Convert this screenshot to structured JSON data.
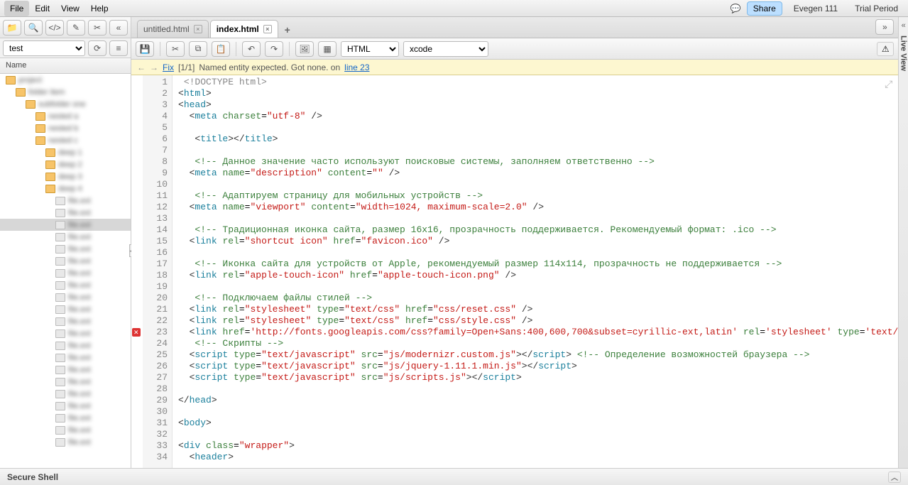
{
  "menubar": {
    "items": [
      "File",
      "Edit",
      "View",
      "Help"
    ],
    "share": "Share",
    "user": "Evegen 111",
    "trial": "Trial Period"
  },
  "sidebar": {
    "search_value": "test",
    "header": "Name",
    "tree": [
      {
        "depth": 0,
        "type": "folder",
        "label": "project",
        "selected": false
      },
      {
        "depth": 1,
        "type": "folder",
        "label": "folder item",
        "selected": false
      },
      {
        "depth": 2,
        "type": "folder",
        "label": "subfolder one",
        "selected": false
      },
      {
        "depth": 3,
        "type": "folder",
        "label": "nested a",
        "selected": false
      },
      {
        "depth": 3,
        "type": "folder",
        "label": "nested b",
        "selected": false
      },
      {
        "depth": 3,
        "type": "folder",
        "label": "nested c",
        "selected": false
      },
      {
        "depth": 4,
        "type": "folder",
        "label": "deep 1",
        "selected": false
      },
      {
        "depth": 4,
        "type": "folder",
        "label": "deep 2",
        "selected": false
      },
      {
        "depth": 4,
        "type": "folder",
        "label": "deep 3",
        "selected": false
      },
      {
        "depth": 4,
        "type": "folder",
        "label": "deep 4",
        "selected": false
      },
      {
        "depth": 5,
        "type": "file",
        "label": "file.ext",
        "selected": false
      },
      {
        "depth": 5,
        "type": "file",
        "label": "file.ext",
        "selected": false
      },
      {
        "depth": 5,
        "type": "file",
        "label": "file.ext",
        "selected": true
      },
      {
        "depth": 5,
        "type": "file",
        "label": "file.ext",
        "selected": false
      },
      {
        "depth": 5,
        "type": "file",
        "label": "file.ext",
        "selected": false
      },
      {
        "depth": 5,
        "type": "file",
        "label": "file.ext",
        "selected": false
      },
      {
        "depth": 5,
        "type": "file",
        "label": "file.ext",
        "selected": false
      },
      {
        "depth": 5,
        "type": "file",
        "label": "file.ext",
        "selected": false
      },
      {
        "depth": 5,
        "type": "file",
        "label": "file.ext",
        "selected": false
      },
      {
        "depth": 5,
        "type": "file",
        "label": "file.ext",
        "selected": false
      },
      {
        "depth": 5,
        "type": "file",
        "label": "file.ext",
        "selected": false
      },
      {
        "depth": 5,
        "type": "file",
        "label": "file.ext",
        "selected": false
      },
      {
        "depth": 5,
        "type": "file",
        "label": "file.ext",
        "selected": false
      },
      {
        "depth": 5,
        "type": "file",
        "label": "file.ext",
        "selected": false
      },
      {
        "depth": 5,
        "type": "file",
        "label": "file.ext",
        "selected": false
      },
      {
        "depth": 5,
        "type": "file",
        "label": "file.ext",
        "selected": false
      },
      {
        "depth": 5,
        "type": "file",
        "label": "file.ext",
        "selected": false
      },
      {
        "depth": 5,
        "type": "file",
        "label": "file.ext",
        "selected": false
      },
      {
        "depth": 5,
        "type": "file",
        "label": "file.ext",
        "selected": false
      },
      {
        "depth": 5,
        "type": "file",
        "label": "file.ext",
        "selected": false
      },
      {
        "depth": 5,
        "type": "file",
        "label": "file.ext",
        "selected": false
      }
    ]
  },
  "tabs": [
    {
      "label": "untitled.html",
      "active": false
    },
    {
      "label": "index.html",
      "active": true
    }
  ],
  "editor_toolbar": {
    "lang_select": "HTML",
    "theme_select": "xcode"
  },
  "lint": {
    "fix": "Fix",
    "counter": "[1/1]",
    "message": "Named entity expected. Got none. on",
    "line_ref": "line 23"
  },
  "code_lines": [
    {
      "n": 1,
      "html": " <span class='tok-doctype'>&lt;!DOCTYPE html&gt;</span>"
    },
    {
      "n": 2,
      "html": "<span class='tok-punct'>&lt;</span><span class='tok-tag'>html</span><span class='tok-punct'>&gt;</span>"
    },
    {
      "n": 3,
      "html": "<span class='tok-punct'>&lt;</span><span class='tok-tag'>head</span><span class='tok-punct'>&gt;</span>"
    },
    {
      "n": 4,
      "html": "  <span class='tok-punct'>&lt;</span><span class='tok-tag'>meta</span> <span class='tok-attr'>charset</span>=<span class='tok-str'>\"utf-8\"</span> <span class='tok-punct'>/&gt;</span>"
    },
    {
      "n": 5,
      "html": ""
    },
    {
      "n": 6,
      "html": "   <span class='tok-punct'>&lt;</span><span class='tok-tag'>title</span><span class='tok-punct'>&gt;&lt;/</span><span class='tok-tag'>title</span><span class='tok-punct'>&gt;</span>"
    },
    {
      "n": 7,
      "html": ""
    },
    {
      "n": 8,
      "html": "   <span class='tok-comment'>&lt;!-- Данное значение часто используют поисковые системы, заполняем ответственно --&gt;</span>"
    },
    {
      "n": 9,
      "html": "  <span class='tok-punct'>&lt;</span><span class='tok-tag'>meta</span> <span class='tok-attr'>name</span>=<span class='tok-str'>\"description\"</span> <span class='tok-attr'>content</span>=<span class='tok-str'>\"\"</span> <span class='tok-punct'>/&gt;</span>"
    },
    {
      "n": 10,
      "html": ""
    },
    {
      "n": 11,
      "html": "   <span class='tok-comment'>&lt;!-- Адаптируем страницу для мобильных устройств --&gt;</span>"
    },
    {
      "n": 12,
      "html": "  <span class='tok-punct'>&lt;</span><span class='tok-tag'>meta</span> <span class='tok-attr'>name</span>=<span class='tok-str'>\"viewport\"</span> <span class='tok-attr'>content</span>=<span class='tok-str'>\"width=1024, maximum-scale=2.0\"</span> <span class='tok-punct'>/&gt;</span>"
    },
    {
      "n": 13,
      "html": ""
    },
    {
      "n": 14,
      "html": "   <span class='tok-comment'>&lt;!-- Традиционная иконка сайта, размер 16x16, прозрачность поддерживается. Рекомендуемый формат: .ico --&gt;</span>"
    },
    {
      "n": 15,
      "html": "  <span class='tok-punct'>&lt;</span><span class='tok-tag'>link</span> <span class='tok-attr'>rel</span>=<span class='tok-str'>\"shortcut icon\"</span> <span class='tok-attr'>href</span>=<span class='tok-str'>\"favicon.ico\"</span> <span class='tok-punct'>/&gt;</span>"
    },
    {
      "n": 16,
      "html": ""
    },
    {
      "n": 17,
      "html": "   <span class='tok-comment'>&lt;!-- Иконка сайта для устройств от Apple, рекомендуемый размер 114x114, прозрачность не поддерживается --&gt;</span>"
    },
    {
      "n": 18,
      "html": "  <span class='tok-punct'>&lt;</span><span class='tok-tag'>link</span> <span class='tok-attr'>rel</span>=<span class='tok-str'>\"apple-touch-icon\"</span> <span class='tok-attr'>href</span>=<span class='tok-str'>\"apple-touch-icon.png\"</span> <span class='tok-punct'>/&gt;</span>"
    },
    {
      "n": 19,
      "html": ""
    },
    {
      "n": 20,
      "html": "   <span class='tok-comment'>&lt;!-- Подключаем файлы стилей --&gt;</span>"
    },
    {
      "n": 21,
      "html": "  <span class='tok-punct'>&lt;</span><span class='tok-tag'>link</span> <span class='tok-attr'>rel</span>=<span class='tok-str'>\"stylesheet\"</span> <span class='tok-attr'>type</span>=<span class='tok-str'>\"text/css\"</span> <span class='tok-attr'>href</span>=<span class='tok-str'>\"css/reset.css\"</span> <span class='tok-punct'>/&gt;</span>"
    },
    {
      "n": 22,
      "html": "  <span class='tok-punct'>&lt;</span><span class='tok-tag'>link</span> <span class='tok-attr'>rel</span>=<span class='tok-str'>\"stylesheet\"</span> <span class='tok-attr'>type</span>=<span class='tok-str'>\"text/css\"</span> <span class='tok-attr'>href</span>=<span class='tok-str'>\"css/style.css\"</span> <span class='tok-punct'>/&gt;</span>"
    },
    {
      "n": 23,
      "err": true,
      "html": "  <span class='tok-punct'>&lt;</span><span class='tok-tag'>link</span> <span class='tok-attr'>href</span>=<span class='tok-str'>'http://fonts.googleapis.com/css?family=Open+Sans:400,600,700&amp;subset=cyrillic-ext,latin'</span> <span class='tok-attr'>rel</span>=<span class='tok-str'>'stylesheet'</span> <span class='tok-attr'>type</span>=<span class='tok-str'>'text/</span>"
    },
    {
      "n": 24,
      "html": "   <span class='tok-comment'>&lt;!-- Скрипты --&gt;</span>"
    },
    {
      "n": 25,
      "html": "  <span class='tok-punct'>&lt;</span><span class='tok-tag'>script</span> <span class='tok-attr'>type</span>=<span class='tok-str'>\"text/javascript\"</span> <span class='tok-attr'>src</span>=<span class='tok-str'>\"js/modernizr.custom.js\"</span><span class='tok-punct'>&gt;&lt;/</span><span class='tok-tag'>script</span><span class='tok-punct'>&gt;</span> <span class='tok-comment'>&lt;!-- Определение возможностей браузера --&gt;</span>"
    },
    {
      "n": 26,
      "html": "  <span class='tok-punct'>&lt;</span><span class='tok-tag'>script</span> <span class='tok-attr'>type</span>=<span class='tok-str'>\"text/javascript\"</span> <span class='tok-attr'>src</span>=<span class='tok-str'>\"js/jquery-1.11.1.min.js\"</span><span class='tok-punct'>&gt;&lt;/</span><span class='tok-tag'>script</span><span class='tok-punct'>&gt;</span>"
    },
    {
      "n": 27,
      "html": "  <span class='tok-punct'>&lt;</span><span class='tok-tag'>script</span> <span class='tok-attr'>type</span>=<span class='tok-str'>\"text/javascript\"</span> <span class='tok-attr'>src</span>=<span class='tok-str'>\"js/scripts.js\"</span><span class='tok-punct'>&gt;&lt;/</span><span class='tok-tag'>script</span><span class='tok-punct'>&gt;</span>"
    },
    {
      "n": 28,
      "html": ""
    },
    {
      "n": 29,
      "html": "<span class='tok-punct'>&lt;/</span><span class='tok-tag'>head</span><span class='tok-punct'>&gt;</span>"
    },
    {
      "n": 30,
      "html": ""
    },
    {
      "n": 31,
      "html": "<span class='tok-punct'>&lt;</span><span class='tok-tag'>body</span><span class='tok-punct'>&gt;</span>"
    },
    {
      "n": 32,
      "html": ""
    },
    {
      "n": 33,
      "html": "<span class='tok-punct'>&lt;</span><span class='tok-tag'>div</span> <span class='tok-attr'>class</span>=<span class='tok-str'>\"wrapper\"</span><span class='tok-punct'>&gt;</span>"
    },
    {
      "n": 34,
      "html": "  <span class='tok-punct'>&lt;</span><span class='tok-tag'>header</span><span class='tok-punct'>&gt;</span>"
    }
  ],
  "rightstrip": {
    "label": "Live View"
  },
  "statusbar": {
    "text": "Secure Shell"
  }
}
